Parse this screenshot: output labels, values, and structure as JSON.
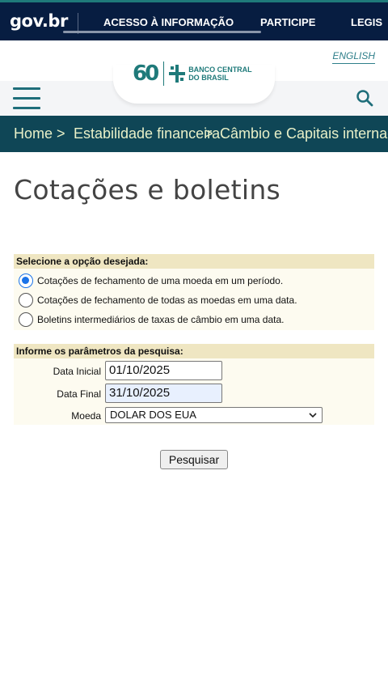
{
  "topbar": {
    "logo": "gov.br",
    "links": [
      "ACESSO À INFORMAÇÃO",
      "PARTICIPE",
      "LEGIS"
    ],
    "bg_color": "#071d41"
  },
  "header": {
    "english_link": "ENGLISH",
    "logo_number": "60",
    "logo_text_line1": "BANCO CENTRAL",
    "logo_text_line2": "DO BRASIL",
    "accent_color": "#1f7a7a"
  },
  "breadcrumb": {
    "items": [
      "Home",
      "Estabilidade financeira",
      "Câmbio e Capitais internacio"
    ],
    "separator": ">",
    "bg_color": "#0f4656"
  },
  "page": {
    "title": "Cotações e boletins"
  },
  "options_panel": {
    "heading": "Selecione a opção desejada:",
    "options": [
      {
        "label": "Cotações de fechamento de uma moeda em um período.",
        "selected": true
      },
      {
        "label": "Cotações de fechamento de todas as moedas em uma data.",
        "selected": false
      },
      {
        "label": "Boletins intermediários de taxas de câmbio em uma data.",
        "selected": false
      }
    ]
  },
  "params_panel": {
    "heading": "Informe os parâmetros da pesquisa:",
    "start_label": "Data Inicial",
    "start_value": "01/10/2025",
    "end_label": "Data Final",
    "end_value": "31/10/2025",
    "currency_label": "Moeda",
    "currency_value": "DOLAR DOS EUA"
  },
  "search_button": "Pesquisar"
}
